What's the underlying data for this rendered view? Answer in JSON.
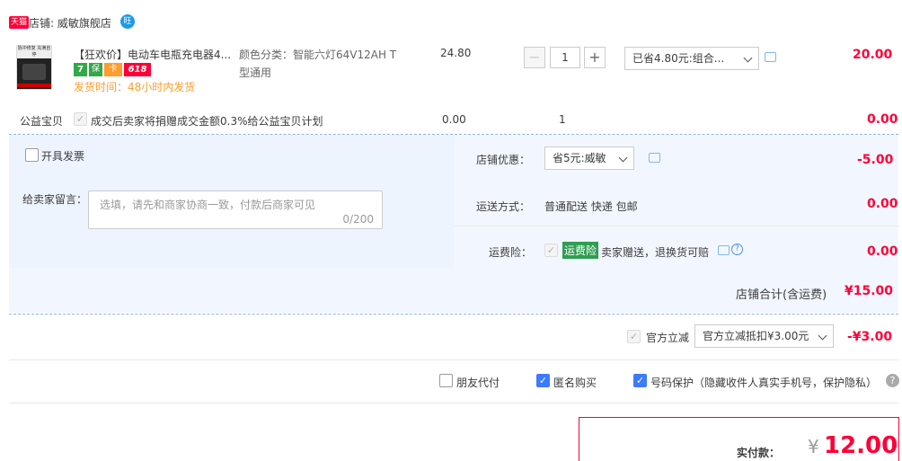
{
  "shop": {
    "badge": "天猫",
    "label": "店铺: 威敏旗舰店",
    "ww": "旺"
  },
  "item": {
    "title": "【狂欢价】电动车电瓶充电器4...",
    "badges": [
      "7",
      "保",
      "卡",
      "618"
    ],
    "ship_time": "发货时间：48小时内发货",
    "sku_label": "颜色分类：智能六灯64V12AH T",
    "sku_label2": "型通用",
    "price": "24.80",
    "qty": "1",
    "promo_select": "已省4.80元:组合...",
    "subtotal": "20.00",
    "thumb_text": "脉冲修复\n充满自停"
  },
  "charity": {
    "label": "公益宝贝",
    "desc": "成交后卖家将捐赠成交金额0.3%给公益宝贝计划",
    "price": "0.00",
    "qty": "1",
    "total": "0.00"
  },
  "invoice": {
    "label": "开具发票"
  },
  "memo": {
    "label": "给卖家留言：",
    "placeholder": "选填，请先和商家协商一致，付款后商家可见",
    "count": "0/200"
  },
  "shop_discount": {
    "label": "店铺优惠：",
    "select": "省5元:威敏",
    "amount": "-5.00"
  },
  "delivery": {
    "label": "运送方式：",
    "value": "普通配送 快递 包邮",
    "amount": "0.00"
  },
  "insurance": {
    "label": "运费险：",
    "tag": "运费险",
    "desc": "卖家赠送，退换货可赔",
    "amount": "0.00"
  },
  "shop_total": {
    "label": "店铺合计(含运费)",
    "amount": "¥15.00"
  },
  "official": {
    "label": "官方立减",
    "select": "官方立减抵扣¥3.00元",
    "amount": "-¥3.00"
  },
  "options": {
    "friend_pay": "朋友代付",
    "anon": "匿名购买",
    "phone_protect": "号码保护（隐藏收件人真实手机号，保护隐私）",
    "help": "?"
  },
  "pay": {
    "label": "实付款：",
    "currency": "¥",
    "amount": "12.00"
  },
  "colors": {
    "accent": "#ff0036",
    "blue_band": "#f2f7ff",
    "checkbox_blue": "#3c7bff",
    "ship_time": "#ff9e2e"
  }
}
